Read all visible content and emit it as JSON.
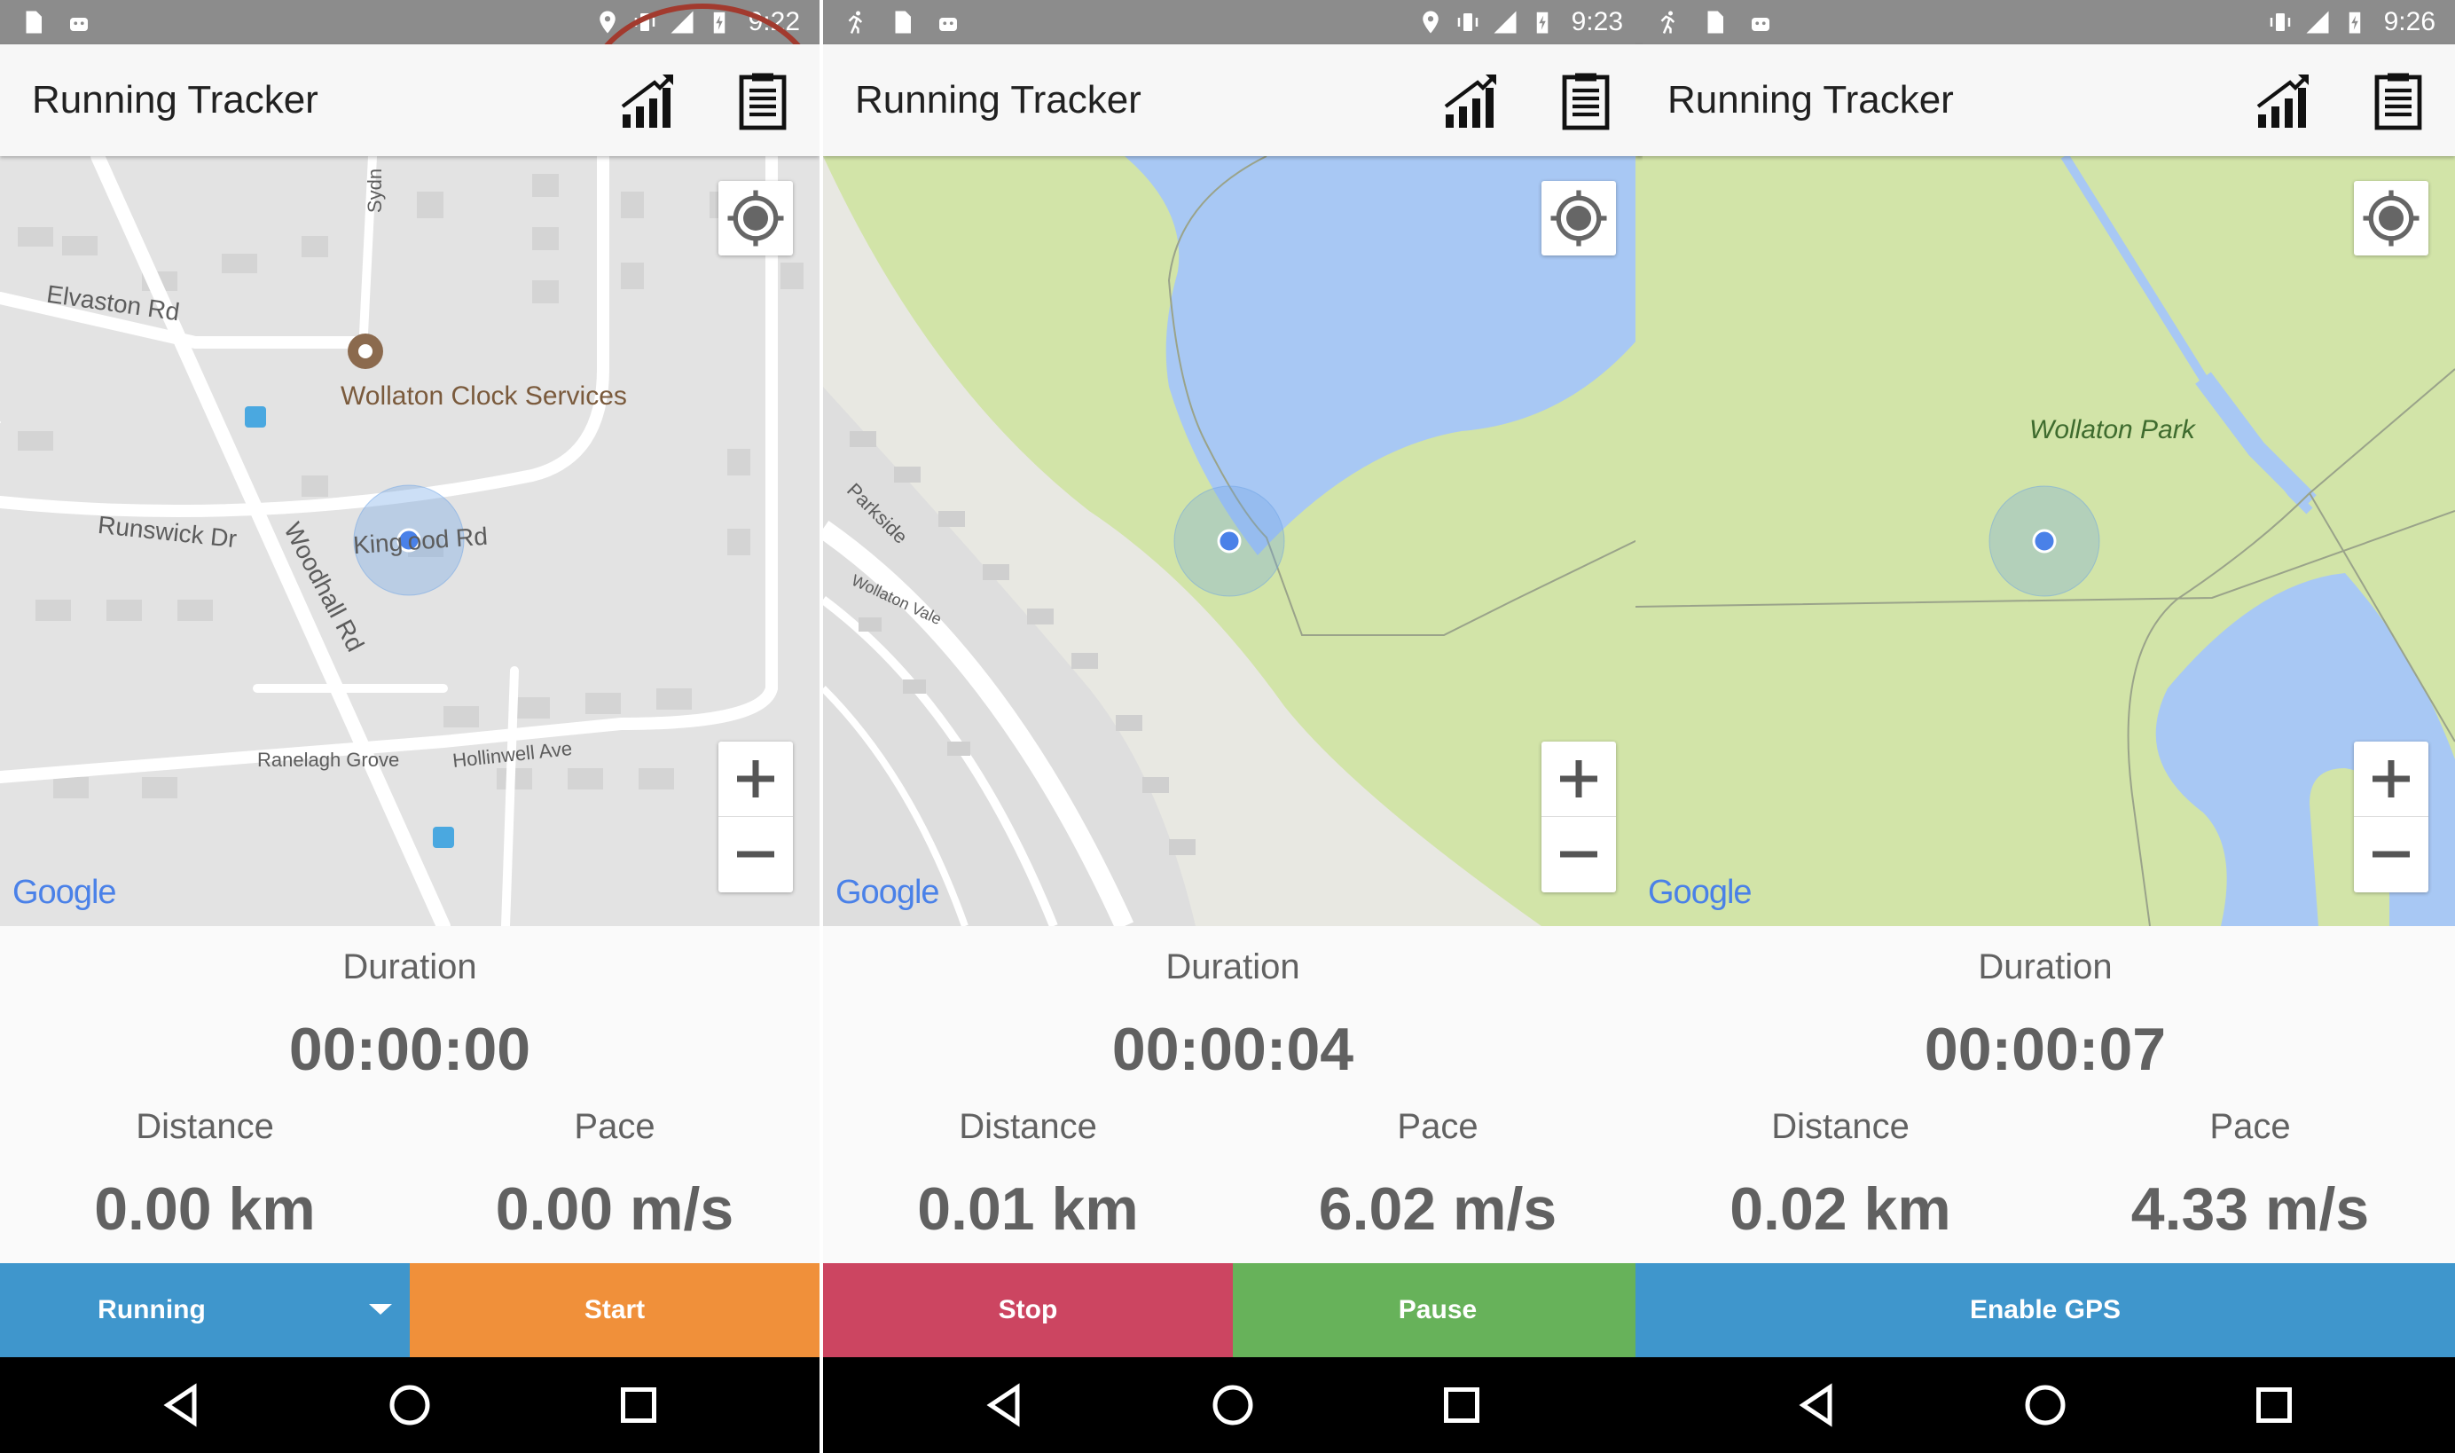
{
  "screens": [
    {
      "status": {
        "time": "9:22"
      },
      "app_title": "Running Tracker",
      "map": {
        "labels": [
          "Elvaston Rd",
          "Wollaton Clock Services",
          "Runswick Dr",
          "Woodhall Rd",
          "King ood Rd",
          "Sydn",
          "Ranelagh Grove",
          "Hollinwell Ave"
        ],
        "google": "Google"
      },
      "stats": {
        "duration_label": "Duration",
        "duration": "00:00:00",
        "distance_label": "Distance",
        "distance": "0.00 km",
        "pace_label": "Pace",
        "pace": "0.00 m/s"
      },
      "buttons": [
        {
          "label": "Running",
          "color": "#3f96cc",
          "dropdown": true
        },
        {
          "label": "Start",
          "color": "#f0903a"
        }
      ]
    },
    {
      "status": {
        "time": "9:23"
      },
      "app_title": "Running Tracker",
      "map": {
        "labels": [
          "Parkside",
          "Wollaton Vale"
        ],
        "google": "Google"
      },
      "stats": {
        "duration_label": "Duration",
        "duration": "00:00:04",
        "distance_label": "Distance",
        "distance": "0.01 km",
        "pace_label": "Pace",
        "pace": "6.02 m/s"
      },
      "buttons": [
        {
          "label": "Stop",
          "color": "#cc4561"
        },
        {
          "label": "Pause",
          "color": "#67b25a"
        }
      ]
    },
    {
      "status": {
        "time": "9:26"
      },
      "app_title": "Running Tracker",
      "map": {
        "labels": [
          "Wollaton Park"
        ],
        "google": "Google"
      },
      "stats": {
        "duration_label": "Duration",
        "duration": "00:00:07",
        "distance_label": "Distance",
        "distance": "0.02 km",
        "pace_label": "Pace",
        "pace": "4.33 m/s"
      },
      "buttons": [
        {
          "label": "Enable GPS",
          "color": "#3f96cc"
        }
      ]
    }
  ],
  "icons": {
    "stats": "stats-bar-chart-icon",
    "history": "clipboard-list-icon",
    "location": "my-location-icon",
    "zoom_in": "plus-icon",
    "zoom_out": "minus-icon",
    "back": "back-triangle-icon",
    "home": "home-circle-icon",
    "recents": "recents-square-icon"
  },
  "colors": {
    "status_bar": "#8c8c8c",
    "app_bar": "#f7f7f7",
    "water": "#a8c8f4",
    "park": "#d2e4a8",
    "map_bg": "#e3e3e3",
    "highlight_circle": "#a23a2e",
    "location_dot": "#4a81e8"
  }
}
